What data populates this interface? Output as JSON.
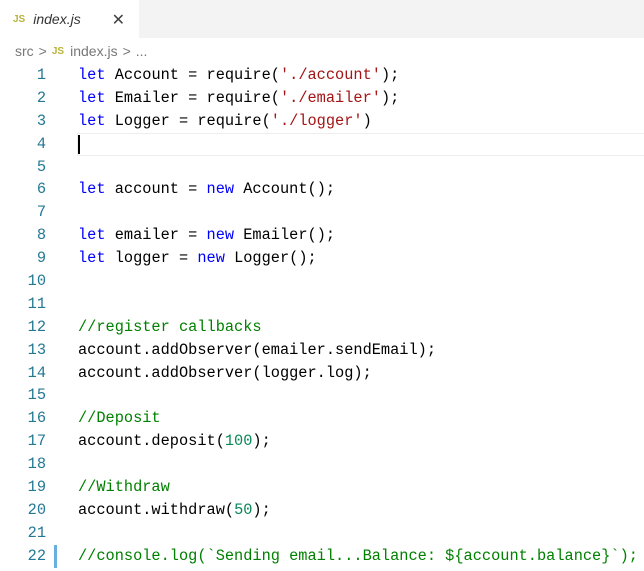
{
  "tab": {
    "icon": "JS",
    "name": "index.js",
    "close": "✕"
  },
  "breadcrumb": [
    "src",
    ">",
    "JS",
    "index.js",
    ">",
    "..."
  ],
  "colors": {
    "kw": "#0000ff",
    "tx": "#000000",
    "st": "#a31515",
    "cm": "#008000",
    "nm": "#098658"
  },
  "lines": [
    [
      [
        "kw",
        "let"
      ],
      [
        "tx",
        " Account = require("
      ],
      [
        "st",
        "'./account'"
      ],
      [
        "tx",
        ");"
      ]
    ],
    [
      [
        "kw",
        "let"
      ],
      [
        "tx",
        " Emailer = require("
      ],
      [
        "st",
        "'./emailer'"
      ],
      [
        "tx",
        ");"
      ]
    ],
    [
      [
        "kw",
        "let"
      ],
      [
        "tx",
        " Logger = require("
      ],
      [
        "st",
        "'./logger'"
      ],
      [
        "tx",
        ")"
      ]
    ],
    [],
    [],
    [
      [
        "kw",
        "let"
      ],
      [
        "tx",
        " account = "
      ],
      [
        "kw",
        "new"
      ],
      [
        "tx",
        " Account();"
      ]
    ],
    [],
    [
      [
        "kw",
        "let"
      ],
      [
        "tx",
        " emailer = "
      ],
      [
        "kw",
        "new"
      ],
      [
        "tx",
        " Emailer();"
      ]
    ],
    [
      [
        "kw",
        "let"
      ],
      [
        "tx",
        " logger = "
      ],
      [
        "kw",
        "new"
      ],
      [
        "tx",
        " Logger();"
      ]
    ],
    [],
    [],
    [
      [
        "cm",
        "//register callbacks"
      ]
    ],
    [
      [
        "tx",
        "account.addObserver(emailer.sendEmail);"
      ]
    ],
    [
      [
        "tx",
        "account.addObserver(logger.log);"
      ]
    ],
    [],
    [
      [
        "cm",
        "//Deposit"
      ]
    ],
    [
      [
        "tx",
        "account.deposit("
      ],
      [
        "nm",
        "100"
      ],
      [
        "tx",
        ");"
      ]
    ],
    [],
    [
      [
        "cm",
        "//Withdraw"
      ]
    ],
    [
      [
        "tx",
        "account.withdraw("
      ],
      [
        "nm",
        "50"
      ],
      [
        "tx",
        ");"
      ]
    ],
    [],
    [
      [
        "cm",
        "//console.log(`Sending email...Balance: ${account.balance}`);"
      ]
    ]
  ],
  "cursor_line": 4,
  "modified_line": 22
}
